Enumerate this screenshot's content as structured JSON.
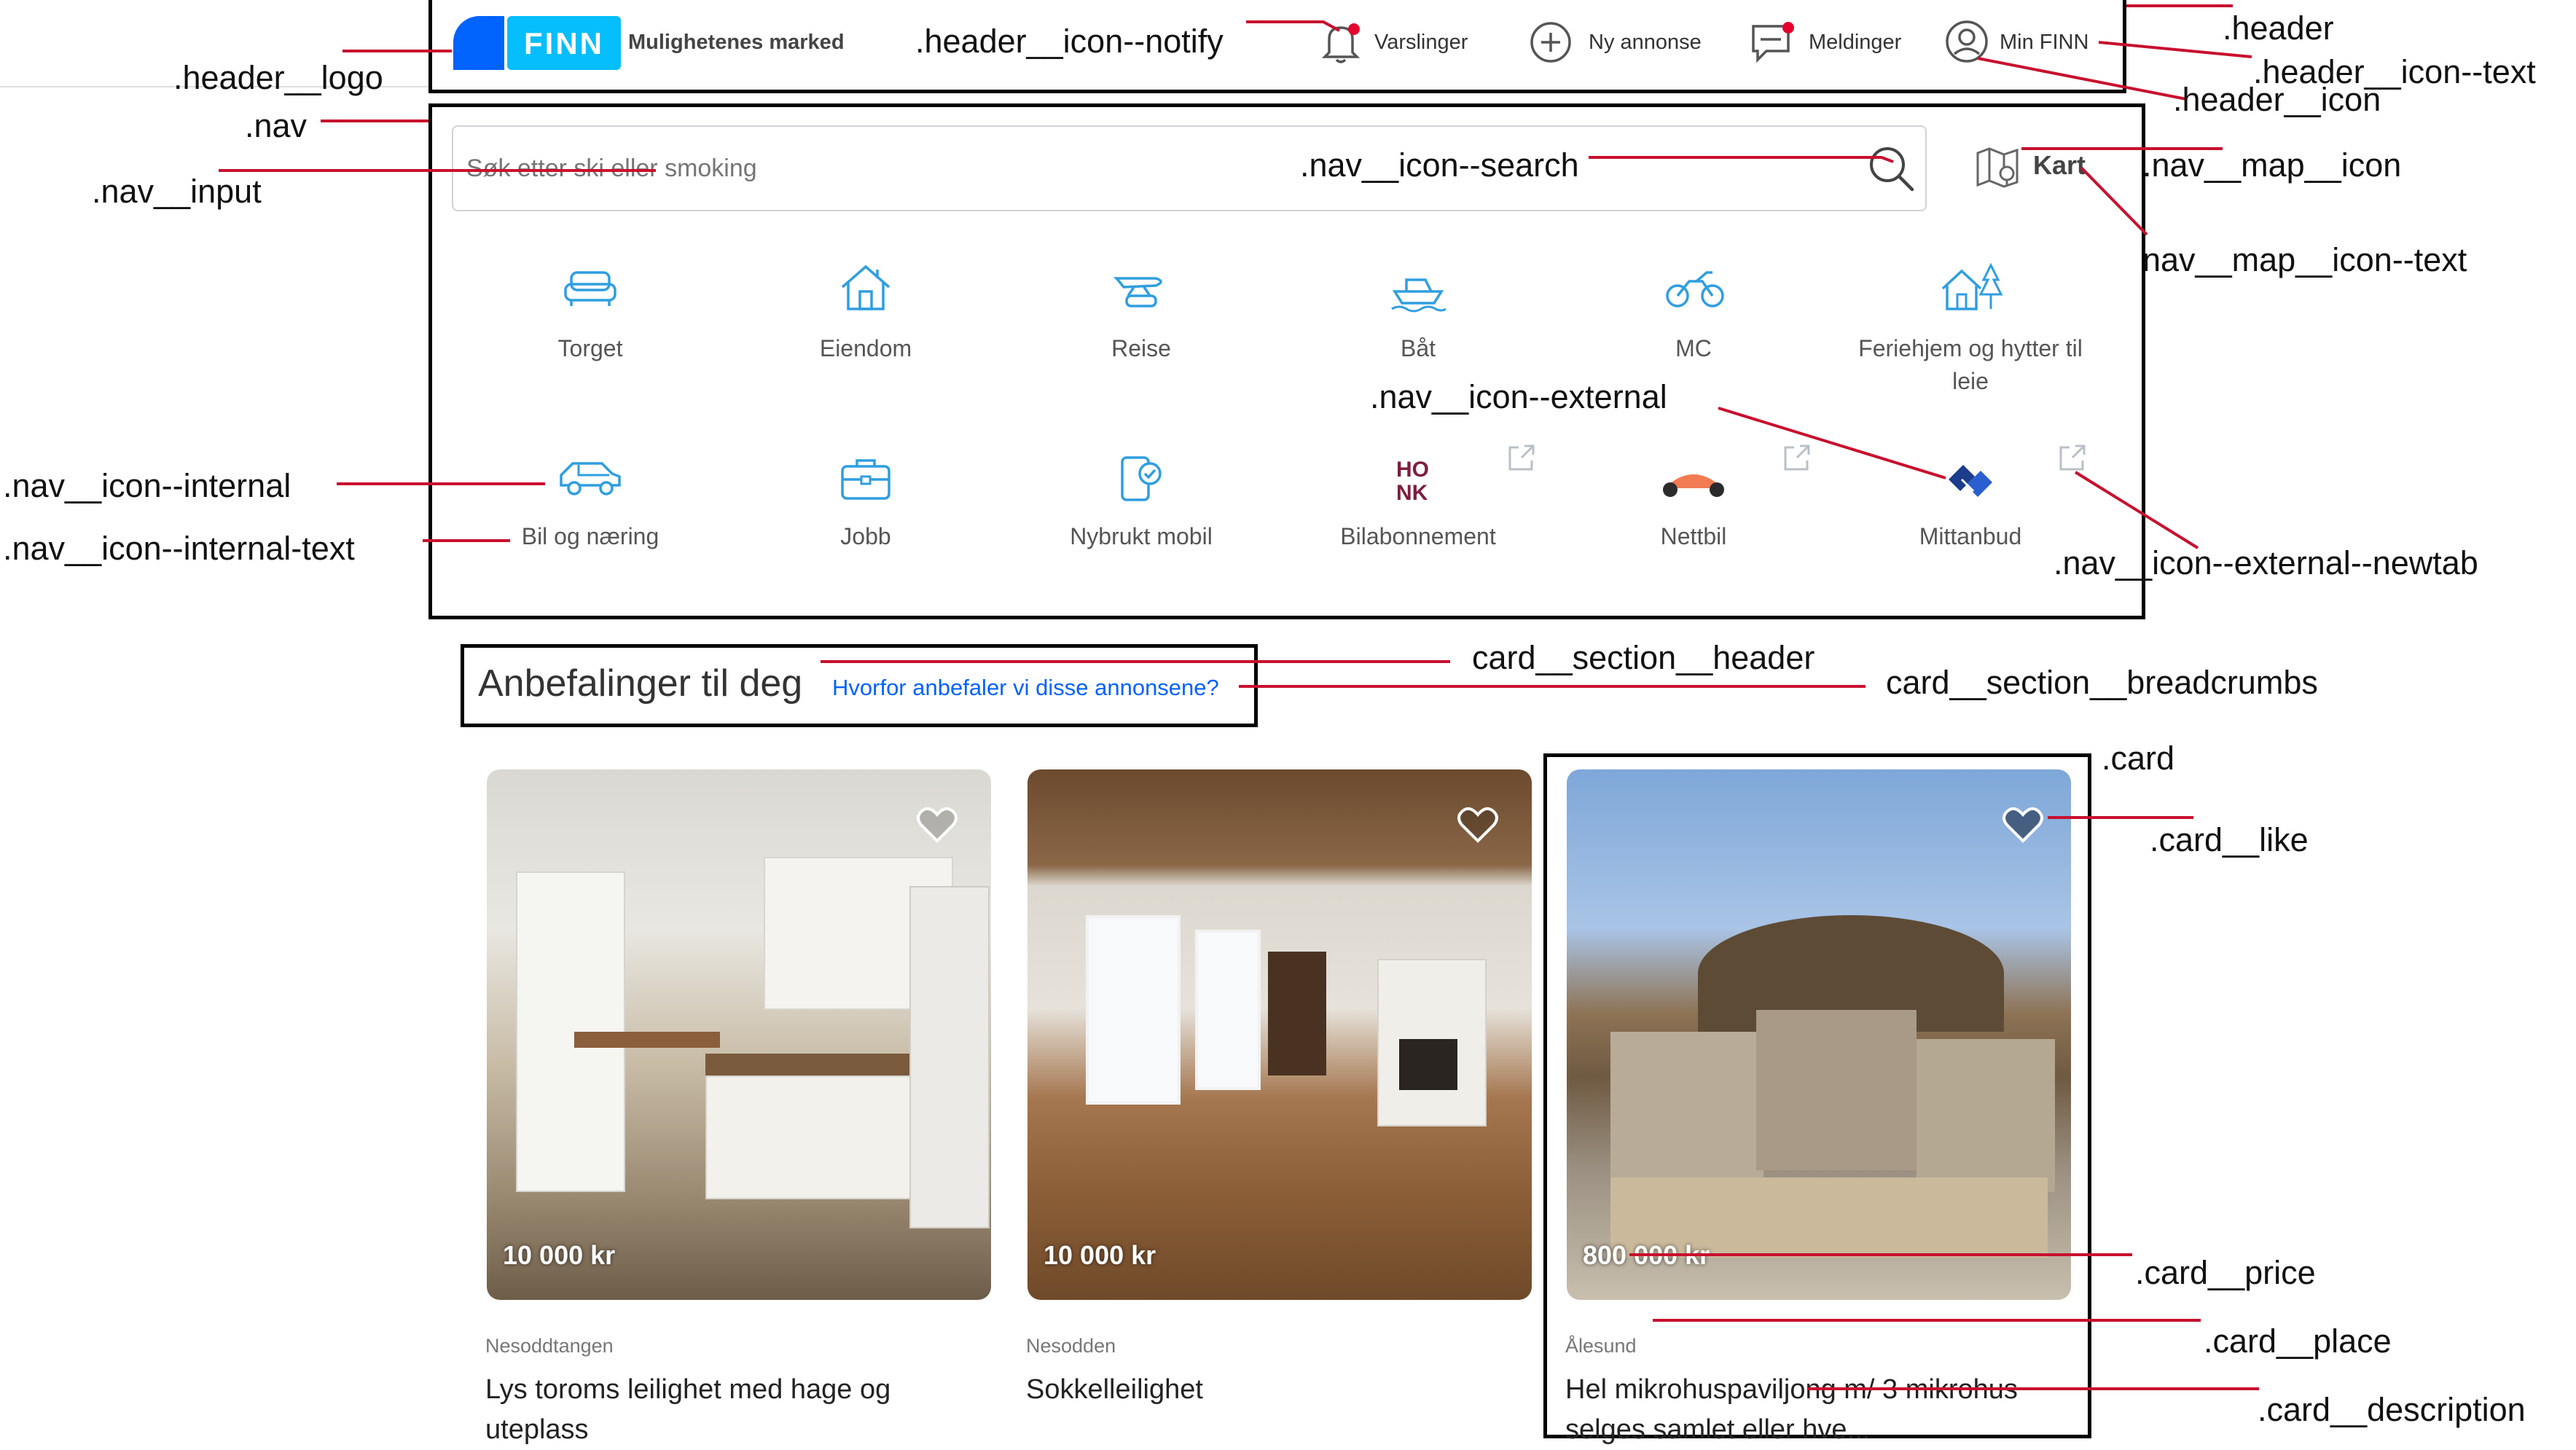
{
  "header": {
    "logo_text": "FINN",
    "tagline": "Mulighetenes marked",
    "items": [
      {
        "label": "Varslinger",
        "icon": "bell-icon"
      },
      {
        "label": "Ny annonse",
        "icon": "plus-circle-icon"
      },
      {
        "label": "Meldinger",
        "icon": "chat-icon"
      },
      {
        "label": "Min FINN",
        "icon": "user-icon"
      }
    ]
  },
  "nav": {
    "search_placeholder": "Søk etter ski eller smoking",
    "map_label": "Kart",
    "categories": [
      {
        "label": "Torget",
        "icon": "sofa-icon"
      },
      {
        "label": "Eiendom",
        "icon": "house-icon"
      },
      {
        "label": "Reise",
        "icon": "plane-icon"
      },
      {
        "label": "Båt",
        "icon": "boat-icon"
      },
      {
        "label": "MC",
        "icon": "motorcycle-icon"
      },
      {
        "label": "Feriehjem og hytter til leie",
        "icon": "cabin-icon"
      },
      {
        "label": "Bil og næring",
        "icon": "car-icon"
      },
      {
        "label": "Jobb",
        "icon": "briefcase-icon"
      },
      {
        "label": "Nybrukt mobil",
        "icon": "phone-icon"
      },
      {
        "label": "Bilabonnement",
        "icon": "honk-logo-icon"
      },
      {
        "label": "Nettbil",
        "icon": "nettbil-logo-icon"
      },
      {
        "label": "Mittanbud",
        "icon": "mittanbud-logo-icon"
      }
    ]
  },
  "section": {
    "title": "Anbefalinger til deg",
    "link": "Hvorfor anbefaler vi disse annonsene?"
  },
  "cards": [
    {
      "price": "10 000 kr",
      "place": "Nesoddtangen",
      "description": "Lys toroms leilighet med hage og uteplass"
    },
    {
      "price": "10 000 kr",
      "place": "Nesodden",
      "description": "Sokkelleilighet"
    },
    {
      "price": "800 000 kr",
      "place": "Ålesund",
      "description": "Hel mikrohuspaviljong m/ 3 mikrohus selges samlet eller hve..."
    }
  ],
  "annotations": {
    "header_logo": ".header__logo",
    "nav": ".nav",
    "nav_input": ".nav__input",
    "header_icon_notify": ".header__icon--notify",
    "header": ".header",
    "header_icon_text": ".header__icon--text",
    "header_icon": ".header__icon",
    "nav_icon_search": ".nav__icon--search",
    "nav_map_icon": ".nav__map__icon",
    "nav_map_icon_text": "nav__map__icon--text",
    "nav_icon_external": ".nav__icon--external",
    "nav_icon_internal": ".nav__icon--internal",
    "nav_icon_internal_text": ".nav__icon--internal-text",
    "nav_icon_external_newtab": ".nav__icon--external--newtab",
    "card_section_header": "card__section__header",
    "card_section_breadcrumbs": "card__section__breadcrumbs",
    "card": ".card",
    "card_like": ".card__like",
    "card_price": ".card__price",
    "card_place": ".card__place",
    "card_description": ".card__description"
  },
  "colors": {
    "brand_blue": "#0063fb",
    "icon_blue": "#2f9ee0",
    "leader_red": "#c8102e",
    "link_blue": "#0063fb"
  }
}
